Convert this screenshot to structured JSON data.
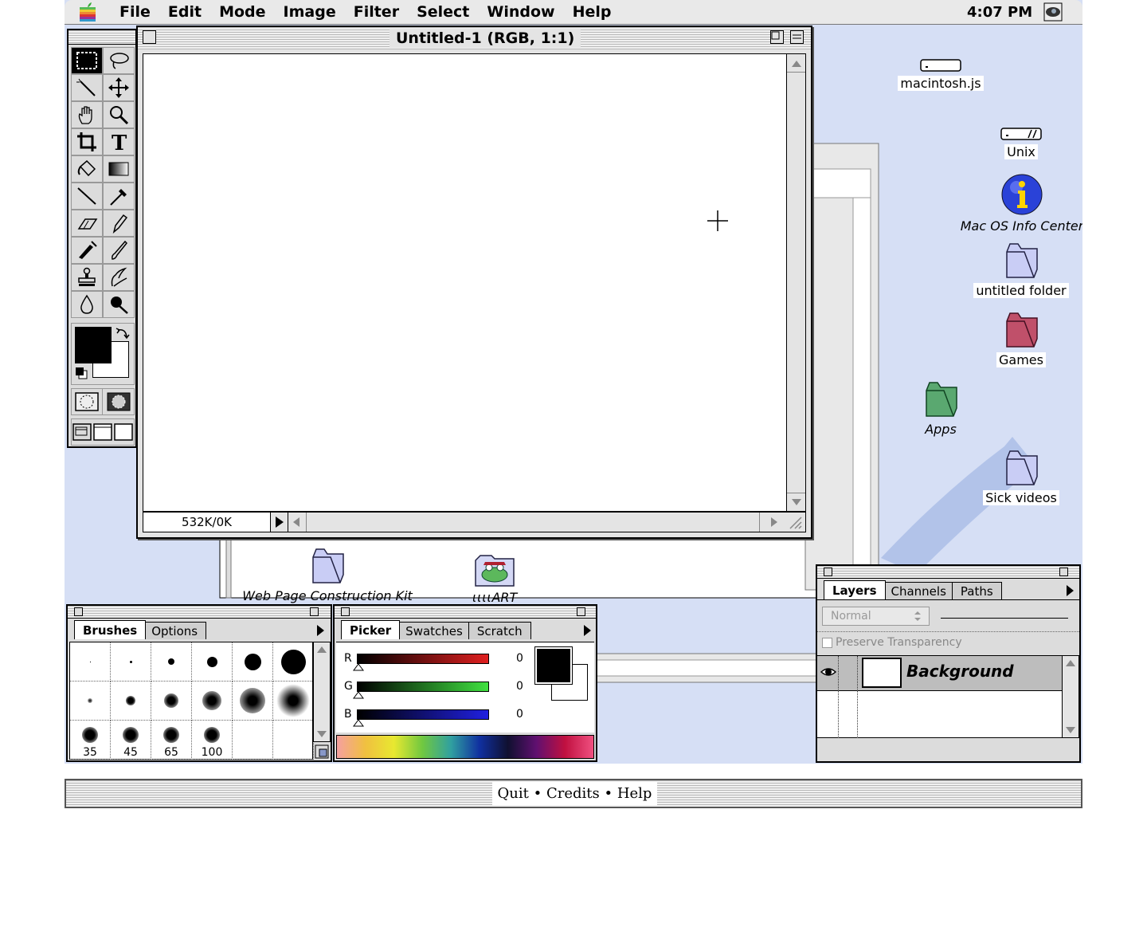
{
  "menubar": {
    "menus": [
      "File",
      "Edit",
      "Mode",
      "Image",
      "Filter",
      "Select",
      "Window",
      "Help"
    ],
    "clock": "4:07 PM"
  },
  "document": {
    "title": "Untitled-1 (RGB, 1:1)",
    "size_info": "532K/0K"
  },
  "desktop": {
    "icons": [
      {
        "label": "macintosh.js",
        "icon": "hard-disk-icon"
      },
      {
        "label": "Unix",
        "icon": "hard-disk-icon"
      },
      {
        "label": "Mac OS Info Center",
        "icon": "info-icon"
      },
      {
        "label": "untitled folder",
        "icon": "folder-icon"
      },
      {
        "label": "Games",
        "icon": "folder-icon",
        "color": "#c0506a"
      },
      {
        "label": "Apps",
        "icon": "folder-icon",
        "color": "#5aa870"
      },
      {
        "label": "Sick videos",
        "icon": "folder-icon"
      },
      {
        "label": "Web Page Construction Kit",
        "icon": "folder-icon"
      },
      {
        "label": "ɩɩɩɩART",
        "icon": "frog-folder-icon"
      }
    ]
  },
  "brushes": {
    "tabs": [
      "Brushes",
      "Options"
    ],
    "sizes": [
      "35",
      "45",
      "65",
      "100"
    ]
  },
  "picker": {
    "tabs": [
      "Picker",
      "Swatches",
      "Scratch"
    ],
    "channels": [
      {
        "label": "R",
        "value": "0",
        "color": "#e02020"
      },
      {
        "label": "G",
        "value": "0",
        "color": "#40e040"
      },
      {
        "label": "B",
        "value": "0",
        "color": "#2020e0"
      }
    ]
  },
  "layers": {
    "tabs": [
      "Layers",
      "Channels",
      "Paths"
    ],
    "blend_mode": "Normal",
    "preserve_transparency": "Preserve Transparency",
    "layer_name": "Background"
  },
  "footer": {
    "quit": "Quit",
    "credits": "Credits",
    "help": "Help",
    "sep": "•"
  }
}
